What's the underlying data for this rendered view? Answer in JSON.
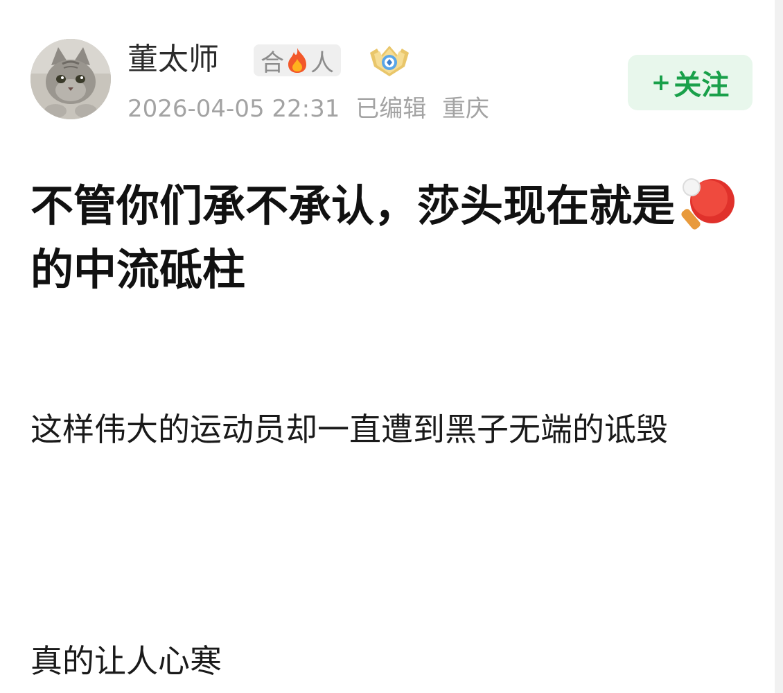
{
  "post": {
    "author": {
      "name": "董太师",
      "badge_left": "合",
      "badge_icon": "fire-icon",
      "badge_right": "人",
      "medal_icon": "medal-icon",
      "avatar_icon": "cat-avatar"
    },
    "meta": {
      "timestamp": "2026-04-05 22:31",
      "edited": "已编辑",
      "location": "重庆"
    },
    "follow_button": {
      "plus": "+",
      "label": "关注"
    },
    "title_part1": "不管你们承不承认，莎头现在就是",
    "title_emoji": "table-tennis-paddle-icon",
    "title_part2": "的中流砥柱",
    "paragraphs": [
      "这样伟大的运动员却一直遭到黑子无端的诋毁",
      "真的让人心寒"
    ]
  },
  "colors": {
    "follow_bg": "#e8f7ec",
    "follow_text": "#19a04a",
    "meta_text": "#a3a3a3",
    "badge_bg": "#efefef"
  }
}
